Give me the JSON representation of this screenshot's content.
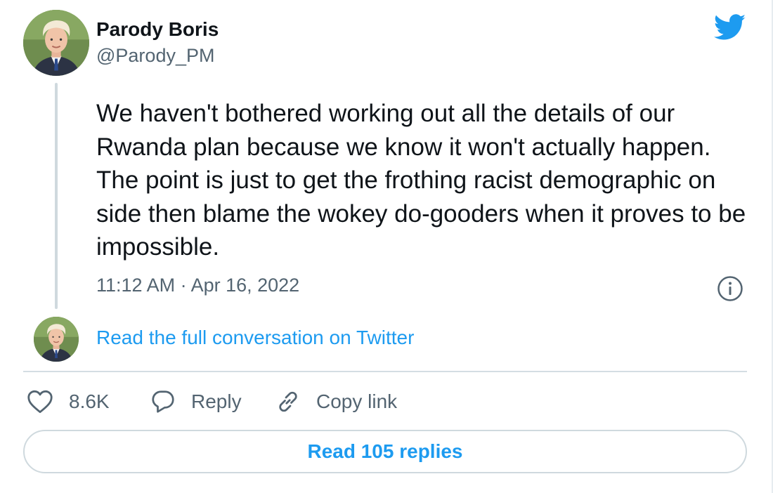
{
  "author": {
    "display_name": "Parody Boris",
    "handle": "@Parody_PM"
  },
  "tweet": {
    "text": "We haven't bothered working out all the details of our Rwanda plan because we know it won't actually happen. The point is just to get the frothing racist demographic on side then blame the wokey do-gooders when it proves to be impossible.",
    "timestamp": "11:12 AM · Apr 16, 2022"
  },
  "conversation_link": "Read the full conversation on Twitter",
  "actions": {
    "like_count": "8.6K",
    "reply_label": "Reply",
    "copy_link_label": "Copy link"
  },
  "read_replies_label": "Read 105 replies",
  "icons": {
    "brand": "twitter-bird-icon",
    "info": "info-icon",
    "like": "heart-icon",
    "reply": "speech-bubble-icon",
    "copy": "link-icon"
  },
  "colors": {
    "accent": "#1d9bf0",
    "text_primary": "#0f1419",
    "text_secondary": "#536471",
    "border": "#cfd9de"
  }
}
